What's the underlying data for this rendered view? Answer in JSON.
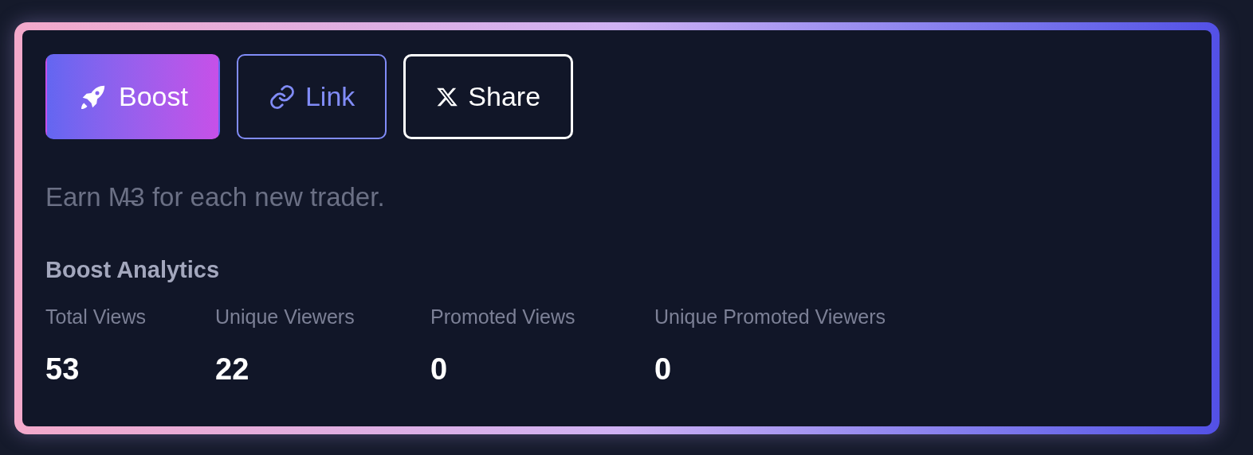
{
  "buttons": [
    {
      "kind": "primary",
      "label": "Boost"
    },
    {
      "kind": "link",
      "label": "Link"
    },
    {
      "kind": "share",
      "label": "Share"
    }
  ],
  "description": "Earn M̶3 for each new trader.",
  "analytics": {
    "title": "Boost Analytics",
    "stats": [
      {
        "label": "Total Views",
        "value": "53"
      },
      {
        "label": "Unique Viewers",
        "value": "22"
      },
      {
        "label": "Promoted Views",
        "value": "0"
      },
      {
        "label": "Unique Promoted Viewers",
        "value": "0"
      }
    ]
  }
}
